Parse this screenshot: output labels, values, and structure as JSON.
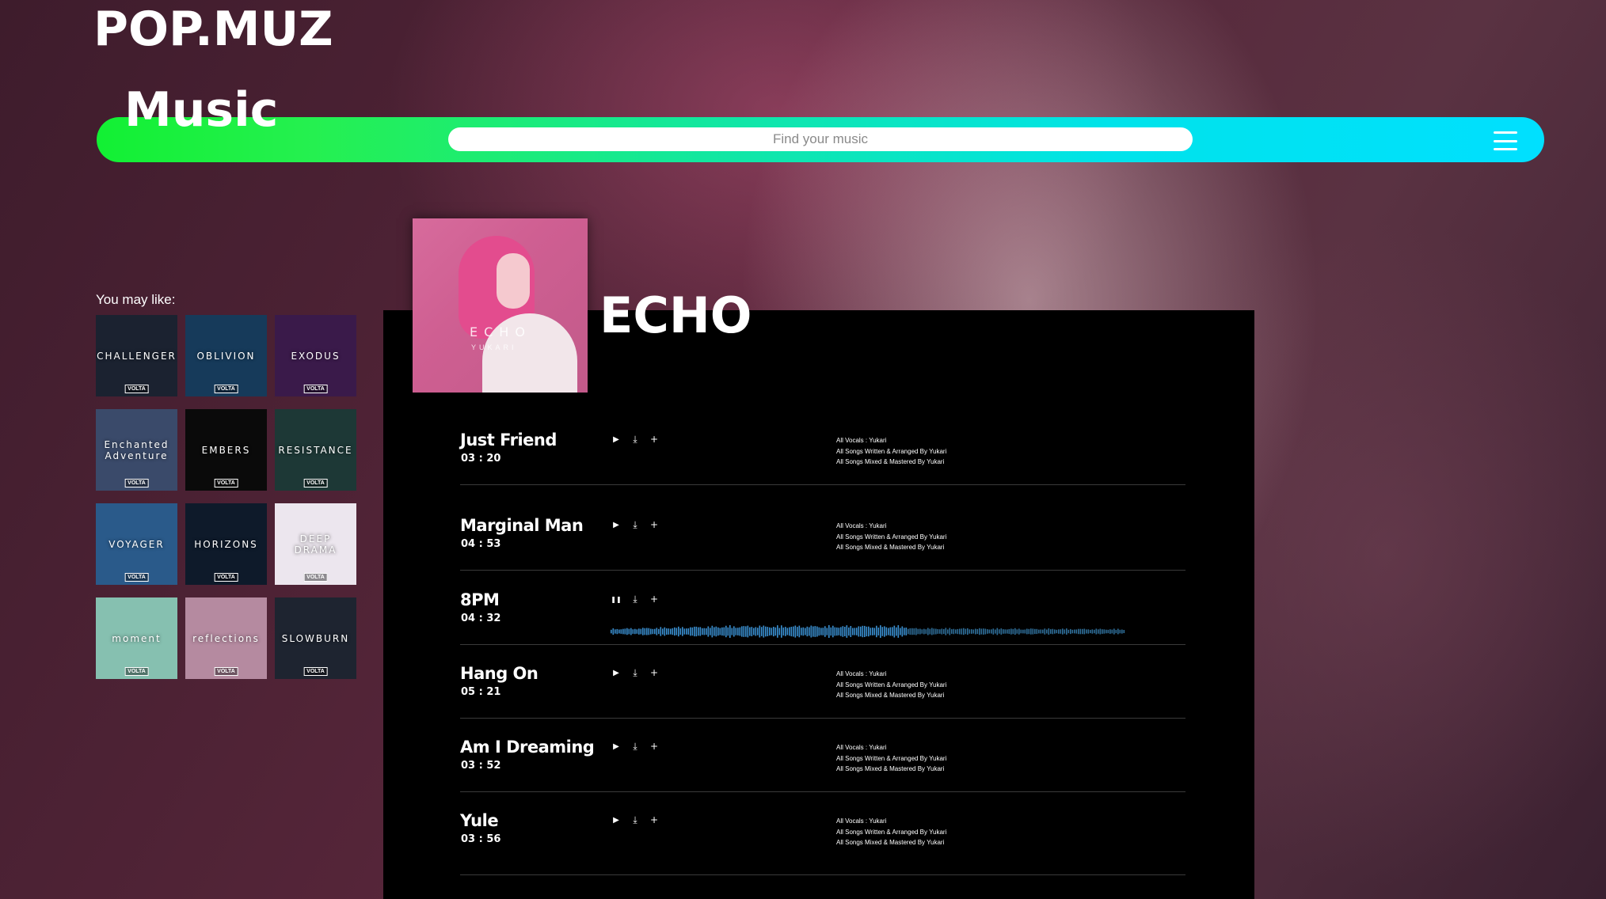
{
  "brand": "POP.MUZ",
  "section_title": "Music",
  "search": {
    "placeholder": "Find your music"
  },
  "sidebar": {
    "heading": "You may like:",
    "albums": [
      {
        "title": "CHALLENGER",
        "badge": "VOLTA",
        "color": "#1b2230"
      },
      {
        "title": "OBLIVION",
        "badge": "VOLTA",
        "color": "#163a5a"
      },
      {
        "title": "EXODUS",
        "badge": "VOLTA",
        "color": "#3a1a4a"
      },
      {
        "title": "Enchanted Adventure",
        "badge": "VOLTA",
        "color": "#3a4a6a"
      },
      {
        "title": "EMBERS",
        "badge": "VOLTA",
        "color": "#0a0a0a"
      },
      {
        "title": "RESISTANCE",
        "badge": "VOLTA",
        "color": "#1d3836"
      },
      {
        "title": "VOYAGER",
        "badge": "VOLTA",
        "color": "#2a5a8a"
      },
      {
        "title": "HORIZONS",
        "badge": "VOLTA",
        "color": "#0e1a2a"
      },
      {
        "title": "DEEP DRAMA",
        "badge": "VOLTA",
        "color": "#ece6ee"
      },
      {
        "title": "moment",
        "badge": "VOLTA",
        "color": "#86c0b0"
      },
      {
        "title": "reflections",
        "badge": "VOLTA",
        "color": "#b58aa0"
      },
      {
        "title": "SLOWBURN",
        "badge": "VOLTA",
        "color": "#1e2430"
      }
    ]
  },
  "album": {
    "title": "ECHO",
    "cover_text": "ECHO",
    "cover_artist": "YUKARI"
  },
  "tracks": [
    {
      "name": "Just Friend",
      "duration": "03 : 20",
      "playing": false,
      "credits": [
        "All Vocals : Yukari",
        "All Songs Written & Arranged By Yukari",
        "All Songs Mixed & Mastered By Yukari"
      ]
    },
    {
      "name": "Marginal Man",
      "duration": "04 : 53",
      "playing": false,
      "credits": [
        "All Vocals : Yukari",
        "All Songs Written & Arranged By Yukari",
        "All Songs Mixed & Mastered By Yukari"
      ]
    },
    {
      "name": "8PM",
      "duration": "04 : 32",
      "playing": true,
      "credits": []
    },
    {
      "name": "Hang On",
      "duration": "05 : 21",
      "playing": false,
      "credits": [
        "All Vocals : Yukari",
        "All Songs Written & Arranged By Yukari",
        "All Songs Mixed & Mastered By Yukari"
      ]
    },
    {
      "name": "Am I Dreaming",
      "duration": "03 : 52",
      "playing": false,
      "credits": [
        "All Vocals : Yukari",
        "All Songs Written & Arranged By Yukari",
        "All Songs Mixed & Mastered By Yukari"
      ]
    },
    {
      "name": "Yule",
      "duration": "03 : 56",
      "playing": false,
      "credits": [
        "All Vocals : Yukari",
        "All Songs Written & Arranged By Yukari",
        "All Songs Mixed & Mastered By Yukari"
      ]
    }
  ],
  "icons": {
    "play": "play-icon",
    "pause": "pause-icon",
    "download": "download-icon",
    "add": "plus-icon",
    "menu": "hamburger-menu-icon"
  },
  "colors": {
    "nav_start": "#12f033",
    "nav_end": "#00e0ff",
    "waveform": "#3a8fd0"
  }
}
